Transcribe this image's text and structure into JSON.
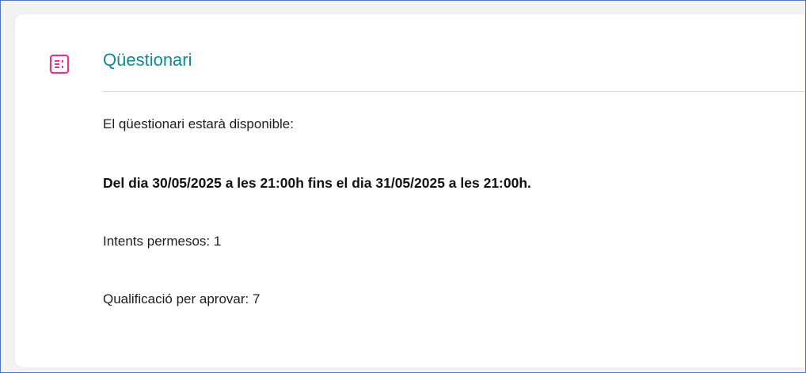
{
  "activity": {
    "title": "Qüestionari",
    "icon": "quiz-icon",
    "accent_color": "#0f8a91",
    "icon_color": "#e5338f"
  },
  "details": {
    "availability_intro": "El qüestionari estarà disponible:",
    "availability_dates": "Del dia 30/05/2025 a les 21:00h fins el dia 31/05/2025 a les 21:00h.",
    "attempts": "Intents permesos: 1",
    "passing_grade": "Qualificació per aprovar: 7"
  }
}
